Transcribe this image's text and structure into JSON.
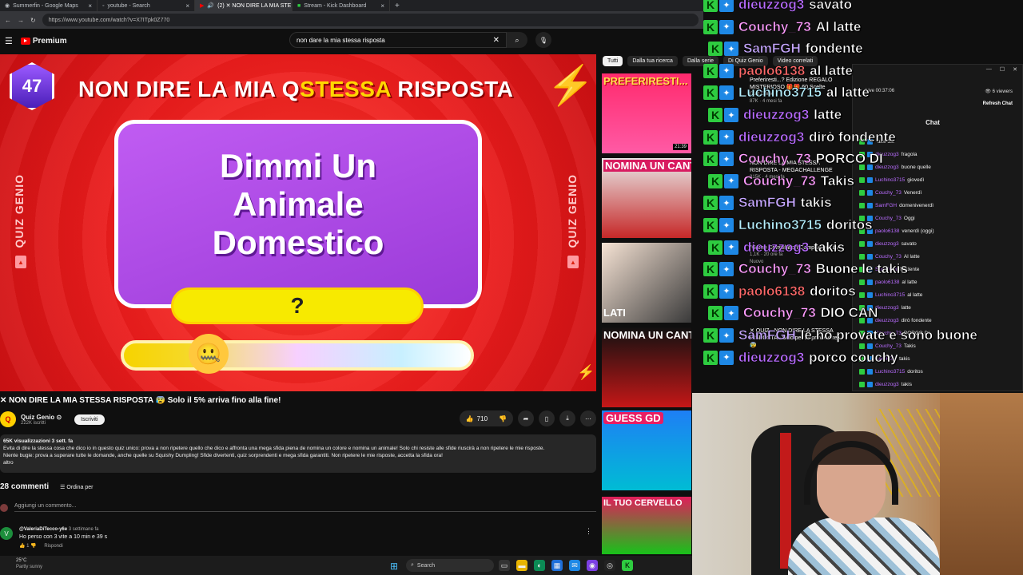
{
  "colors": {
    "yt_red": "#ff0000",
    "kick_green": "#2ecc40",
    "video_bg": "#ea1c1c",
    "card_purple": "#b450ec",
    "answer_yellow": "#f7ea00"
  },
  "browser": {
    "tabs": [
      {
        "label": "Summerfin - Google Maps",
        "icon": "maps-icon"
      },
      {
        "label": "youtube - Search",
        "icon": "search-icon"
      },
      {
        "label": "(2) ✕ NON DIRE LA MIA STE",
        "icon": "youtube-icon",
        "active": true
      },
      {
        "label": "Stream - Kick Dashboard",
        "icon": "kick-icon"
      }
    ],
    "url": "https://www.youtube.com/watch?v=X7ITpk0Z770"
  },
  "youtube": {
    "logo_label": "Premium",
    "search": {
      "value": "non dare la mia stessa risposta"
    },
    "video": {
      "level_badge": "47",
      "title_part1": "NON DIRE LA MIA Q",
      "title_part2": "STESSA",
      "title_part3": " RISPOSTA",
      "side_label_left": "QUIZ GENIO",
      "side_label_right": "QUIZ GENIO",
      "card_line1": "Dimmi Un",
      "card_line2": "Animale",
      "card_line3": "Domestico",
      "answer": "?",
      "progress": 0.25
    },
    "title": "✕ NON DIRE LA MIA STESSA RISPOSTA 😰 Solo il 5% arriva fino alla fine!",
    "channel": {
      "name": "Quiz Genio ⊙",
      "subs": "222K iscritti",
      "subscribe_label": "Iscriviti",
      "avatar_text": "Q"
    },
    "likes": "710",
    "description": {
      "meta": "65K visualizzazioni  3 sett. fa",
      "line1": "Evita di dire la stessa cosa che dico io in questo quiz unico: prova a non ripetere quello che dico e affronta una mega sfida piena de nomina un colore e nomina un animale! Solo chi resiste alle sfide riuscirà a non ripetere le mie risposte.",
      "line2": "Niente bugie: prova a superare tutte le domande, anche quelle su Squishy Dumpling! Sfide divertenti, quiz sorprendenti e mega sfida garantiti. Non ripetere le mie risposte, accetta la sfida ora!",
      "more": "altro"
    },
    "comments": {
      "count": "28 commenti",
      "sort_label": "Ordina per",
      "add_placeholder": "Aggiungi un commento...",
      "items": [
        {
          "author": "@ValeriaDiTecco-y6e",
          "time": "3 settimane fa",
          "text": "Ho perso con 3 vite a 10 min e 39 s",
          "likes": "1",
          "reply_label": "Rispondi"
        }
      ]
    },
    "chips": [
      "Tutti",
      "Dalla tua ricerca",
      "Dalla serie",
      "Di Quiz Genio",
      "Video correlati"
    ],
    "recommended": [
      {
        "thumb_label": "PREFERIRESTI...",
        "title": "Preferiresti...? Edizione REGALO MISTERIOSO 🎁🎁 60 Scelte",
        "channel": "Quiz Genio",
        "stats": "87K · 4 mesi fa",
        "duration": "21:39"
      },
      {
        "thumb_label": "NOMINA UN CANTANTE",
        "title": "NON DIRE LA MIA STESSA RISPOSTA - MEGACHALLENGE",
        "channel": "Quiz Genio",
        "stats": "915K · 4 mesi fa"
      },
      {
        "thumb_label": "LATI",
        "title": "\"Game Compilation Compilation\" by ...",
        "channel": "",
        "stats": "1,1K · 20 ore fa",
        "badge": "Nuovo"
      },
      {
        "thumb_label": "NOMINA UN CANTANTE",
        "title": "✕ QUIZ - NON DIRE LA STESSA RISPOSTA - Solo per Sopravvivere! 😰",
        "channel": "",
        "stats": ""
      },
      {
        "thumb_label": "GUESS GD",
        "title": "",
        "channel": "",
        "stats": ""
      },
      {
        "thumb_label": "IL TUO CERVELLO",
        "title": "",
        "channel": "",
        "stats": ""
      }
    ]
  },
  "overlay_chat": [
    {
      "user": "dieuzzog3",
      "msg": "savato",
      "color": "#b96cff"
    },
    {
      "user": "Couchy_73",
      "msg": "Al latte",
      "color": "#ff9dff"
    },
    {
      "user": "SamFGH",
      "msg": "fondente",
      "color": "#c6a7ff"
    },
    {
      "user": "paolo6138",
      "msg": "al latte",
      "color": "#ff6a6a"
    },
    {
      "user": "Luchino3715",
      "msg": "al latte",
      "color": "#b6f0ff"
    },
    {
      "user": "dieuzzog3",
      "msg": "latte",
      "color": "#b96cff"
    },
    {
      "user": "dieuzzog3",
      "msg": "dirò fondente",
      "color": "#b96cff"
    },
    {
      "user": "Couchy_73",
      "msg": "PORCO DI",
      "color": "#ff9dff"
    },
    {
      "user": "Couchy_73",
      "msg": "Takis",
      "color": "#ff9dff"
    },
    {
      "user": "SamFGH",
      "msg": "takis",
      "color": "#c6a7ff"
    },
    {
      "user": "Luchino3715",
      "msg": "doritos",
      "color": "#b6f0ff"
    },
    {
      "user": "dieuzzog3",
      "msg": "takis",
      "color": "#b96cff"
    },
    {
      "user": "Couchy_73",
      "msg": "Buone le takis",
      "color": "#ff9dff"
    },
    {
      "user": "paolo6138",
      "msg": "doritos",
      "color": "#ff6a6a"
    },
    {
      "user": "Couchy_73",
      "msg": "DIO CAN",
      "color": "#ff9dff"
    },
    {
      "user": "SamFGH",
      "msg": "le ho provate e sono buone",
      "color": "#c6a7ff"
    },
    {
      "user": "dieuzzog3",
      "msg": "porco couchy",
      "color": "#b96cff"
    }
  ],
  "kick": {
    "window_controls": [
      "—",
      "☐",
      "✕"
    ],
    "live_time": "Live 00:37:06",
    "viewers": "6 viewers",
    "refresh_label": "Refresh Chat",
    "chat_title": "Chat",
    "messages": [
      {
        "user": "",
        "text": "ake 1st"
      },
      {
        "user": "dieuzzog3",
        "text": "fragola"
      },
      {
        "user": "dieuzzog3",
        "text": "buone quelle"
      },
      {
        "user": "Luchino3715",
        "text": "giovedì"
      },
      {
        "user": "Couchy_73",
        "text": "Venerdì"
      },
      {
        "user": "SamFGH",
        "text": "domenivenerdì"
      },
      {
        "user": "Couchy_73",
        "text": "Oggi"
      },
      {
        "user": "paolo6138",
        "text": "venerdì (oggi)"
      },
      {
        "user": "dieuzzog3",
        "text": "savato"
      },
      {
        "user": "Couchy_73",
        "text": "Al latte"
      },
      {
        "user": "SamFGH",
        "text": "fondente"
      },
      {
        "user": "paolo6138",
        "text": "al latte"
      },
      {
        "user": "Luchino3715",
        "text": "al latte"
      },
      {
        "user": "dieuzzog3",
        "text": "latte"
      },
      {
        "user": "dieuzzog3",
        "text": "dirò fondente"
      },
      {
        "user": "Couchy_73",
        "text": "PORCO DI"
      },
      {
        "user": "Couchy_73",
        "text": "Takis"
      },
      {
        "user": "SamFGH",
        "text": "takis"
      },
      {
        "user": "Luchino3715",
        "text": "doritos"
      },
      {
        "user": "dieuzzog3",
        "text": "takis"
      }
    ]
  },
  "taskbar": {
    "weather_temp": "25°C",
    "weather_desc": "Partly sunny",
    "search_label": "Search"
  }
}
